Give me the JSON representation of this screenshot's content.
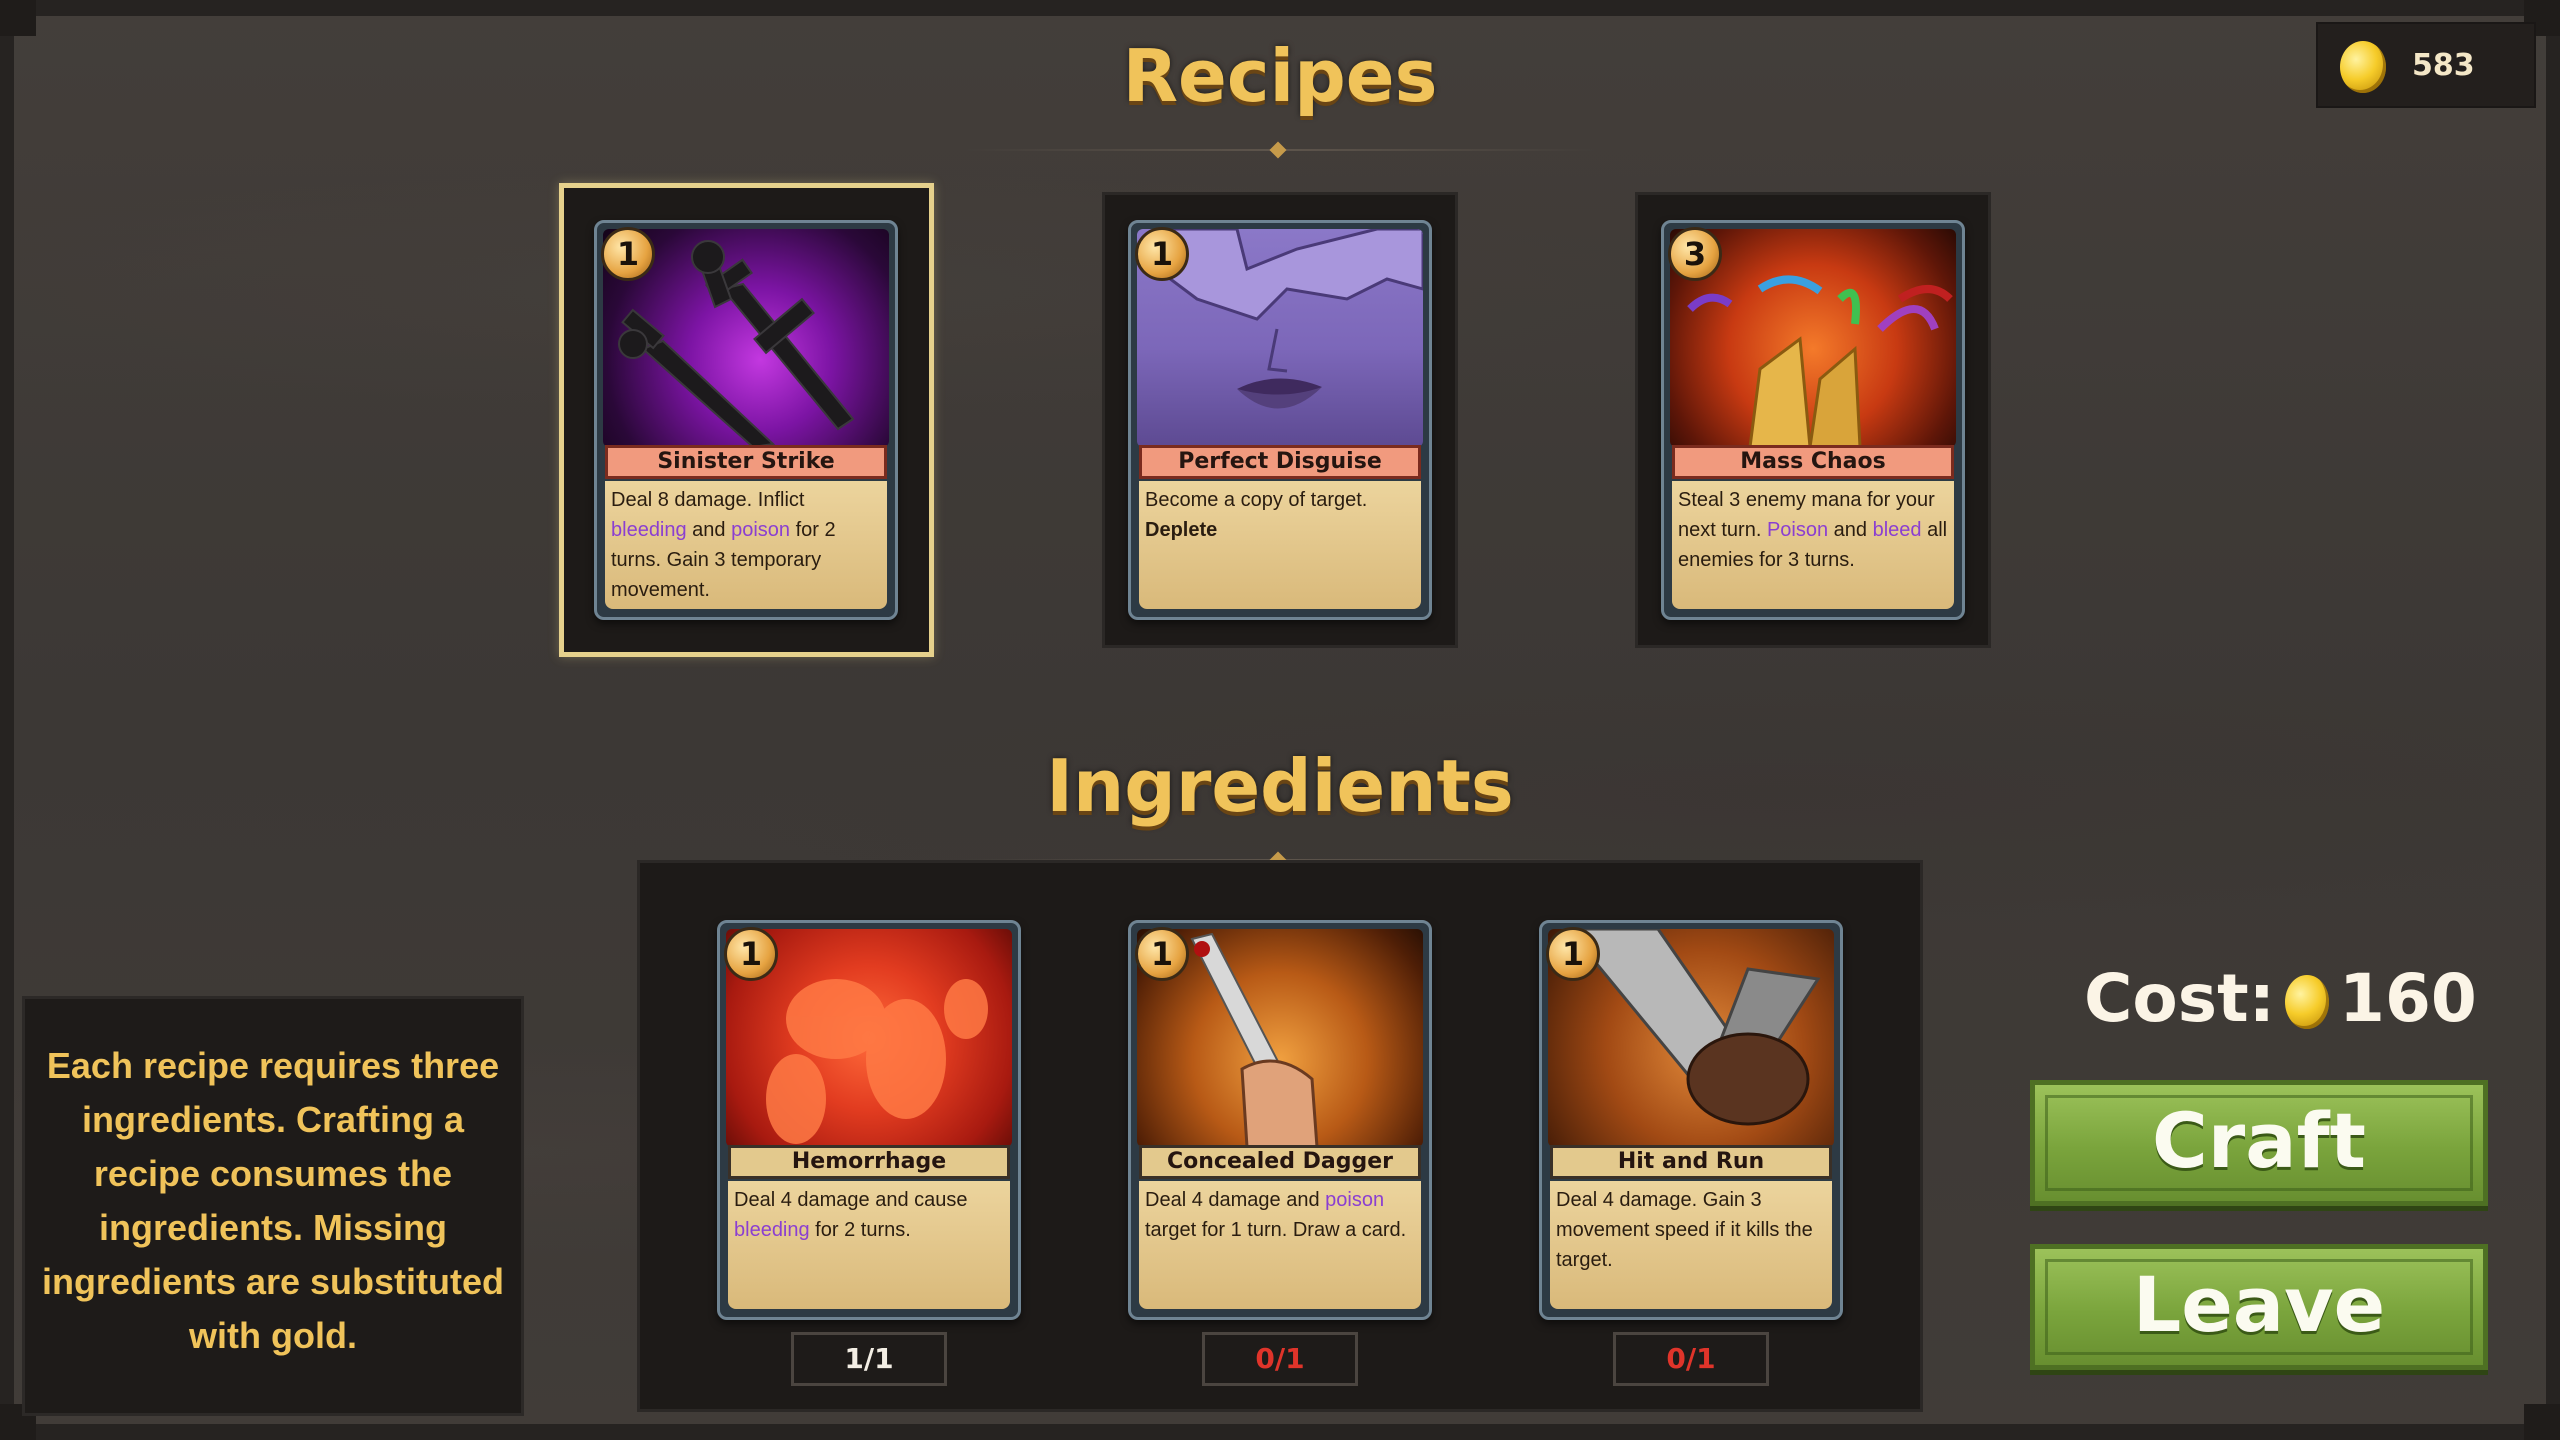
{
  "gold": {
    "amount": "583"
  },
  "recipes_title": "Recipes",
  "ingredients_title": "Ingredients",
  "recipes": [
    {
      "cost": "1",
      "name": "Sinister Strike",
      "art": "crossed-daggers-purple",
      "desc": [
        {
          "t": "Deal 8 damage. Inflict "
        },
        {
          "t": "bleeding",
          "hl": true
        },
        {
          "t": " and "
        },
        {
          "t": "poison",
          "hl": true
        },
        {
          "t": " for 2 turns. Gain 3 temporary movement."
        }
      ]
    },
    {
      "cost": "1",
      "name": "Perfect Disguise",
      "art": "purple-face",
      "desc": [
        {
          "t": "Become a copy of target. "
        },
        {
          "t": "Deplete",
          "b": true
        }
      ]
    },
    {
      "cost": "3",
      "name": "Mass Chaos",
      "art": "chaos-horns",
      "desc": [
        {
          "t": "Steal 3 enemy mana for your next turn. "
        },
        {
          "t": "Poison",
          "hl": true
        },
        {
          "t": " and "
        },
        {
          "t": "bleed",
          "hl": true
        },
        {
          "t": " all enemies for 3 turns."
        }
      ]
    }
  ],
  "ingredients": [
    {
      "cost": "1",
      "name": "Hemorrhage",
      "art": "blood-splash",
      "count": "1/1",
      "count_color": "#f3eee4",
      "desc": [
        {
          "t": "Deal 4 damage and cause "
        },
        {
          "t": "bleeding",
          "hl": true
        },
        {
          "t": " for 2 turns."
        }
      ]
    },
    {
      "cost": "1",
      "name": "Concealed Dagger",
      "art": "hand-dagger",
      "count": "0/1",
      "count_color": "#e0342a",
      "desc": [
        {
          "t": "Deal 4 damage and "
        },
        {
          "t": "poison",
          "hl": true
        },
        {
          "t": " target for 1 turn. Draw a card."
        }
      ]
    },
    {
      "cost": "1",
      "name": "Hit and Run",
      "art": "fist-sword",
      "count": "0/1",
      "count_color": "#e0342a",
      "desc": [
        {
          "t": "Deal 4 damage. Gain 3 movement speed if it kills the target."
        }
      ]
    }
  ],
  "info_text": "Each recipe requires three ingredients. Crafting a recipe consumes the ingredients. Missing ingredients are substituted with gold.",
  "cost": {
    "label": "Cost:",
    "value": "160"
  },
  "buttons": {
    "craft": "Craft",
    "leave": "Leave"
  }
}
